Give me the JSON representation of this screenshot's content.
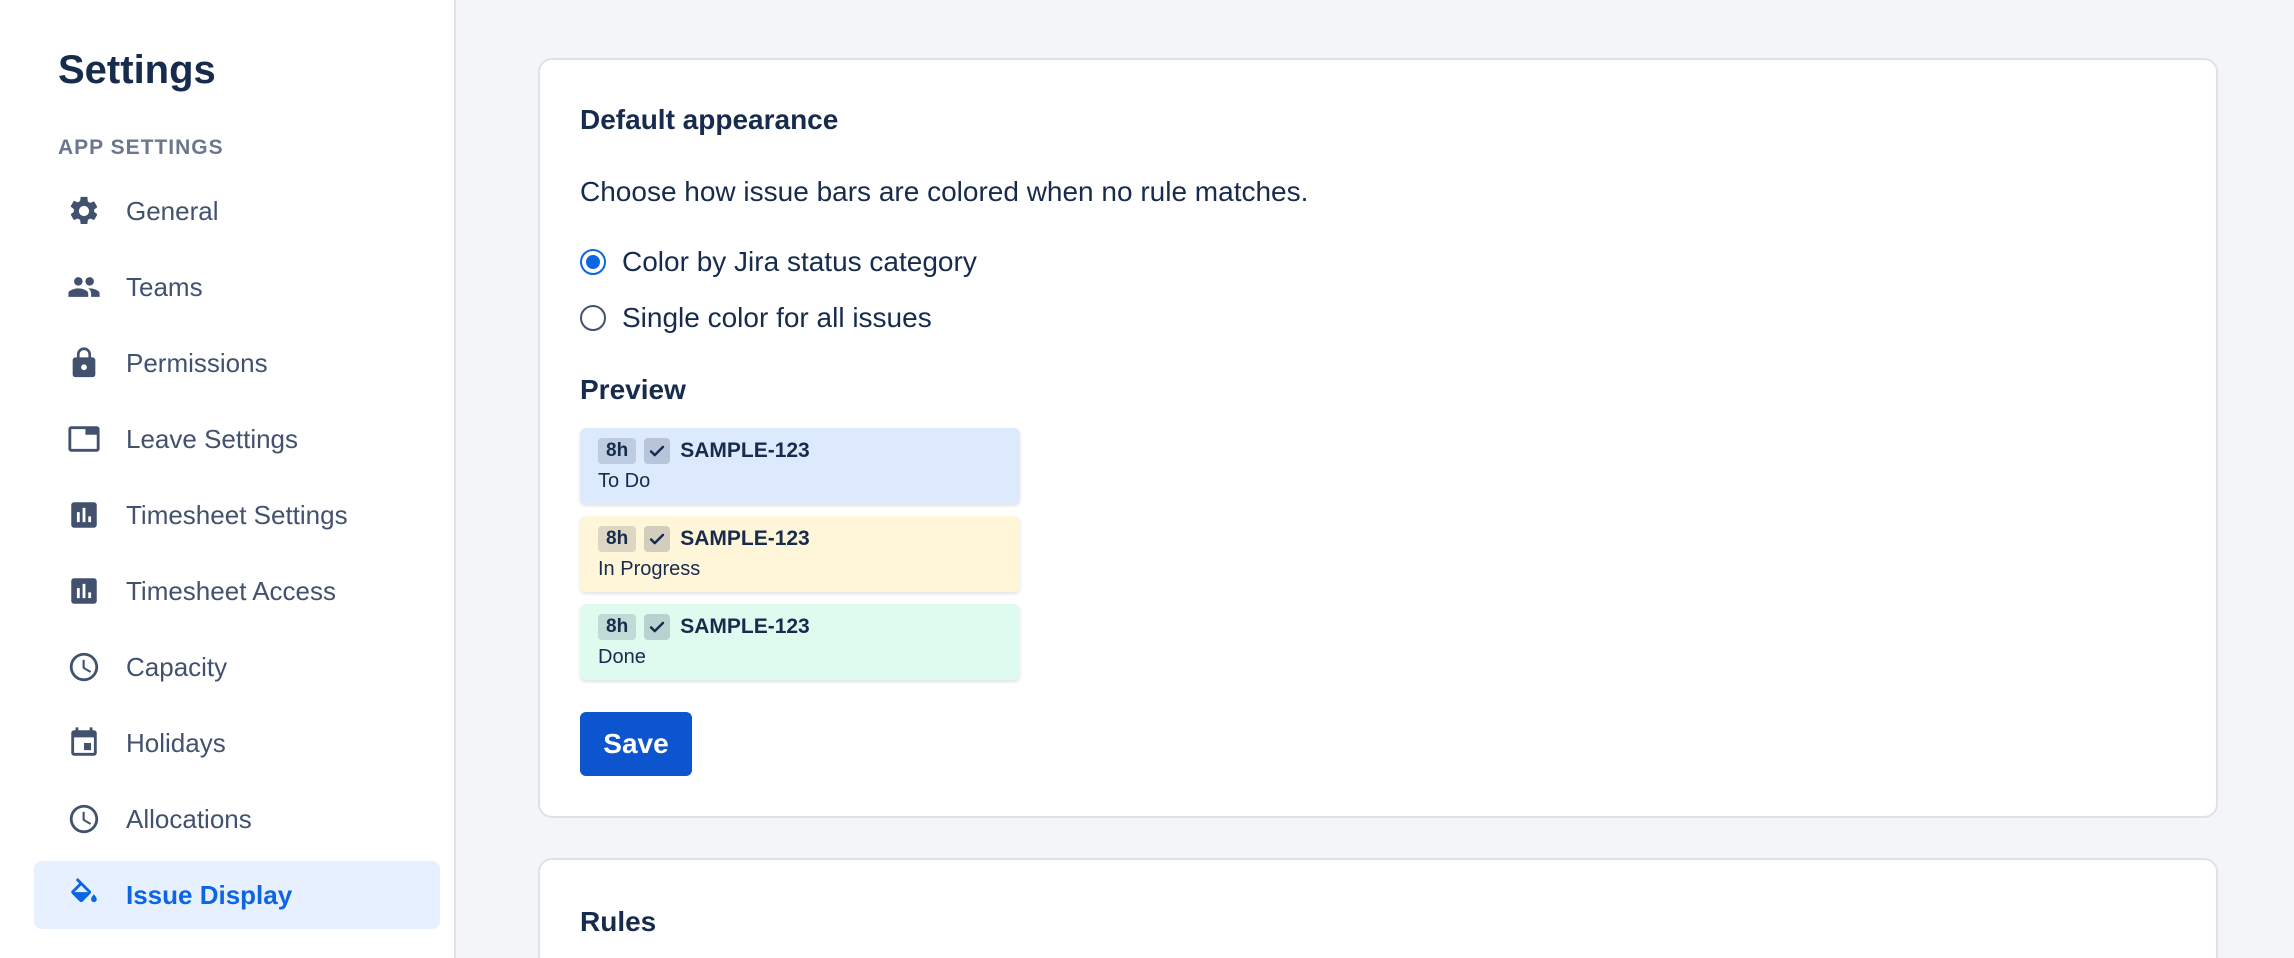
{
  "sidebar": {
    "title": "Settings",
    "section_label": "APP SETTINGS",
    "items": [
      {
        "label": "General",
        "icon": "gear-icon"
      },
      {
        "label": "Teams",
        "icon": "people-icon"
      },
      {
        "label": "Permissions",
        "icon": "lock-icon"
      },
      {
        "label": "Leave Settings",
        "icon": "tab-window-icon"
      },
      {
        "label": "Timesheet Settings",
        "icon": "bar-chart-icon"
      },
      {
        "label": "Timesheet Access",
        "icon": "bar-chart-icon"
      },
      {
        "label": "Capacity",
        "icon": "clock-icon"
      },
      {
        "label": "Holidays",
        "icon": "calendar-icon"
      },
      {
        "label": "Allocations",
        "icon": "clock-icon"
      },
      {
        "label": "Issue Display",
        "icon": "paint-bucket-icon",
        "active": true
      }
    ]
  },
  "default_appearance": {
    "title": "Default appearance",
    "description": "Choose how issue bars are colored when no rule matches.",
    "options": [
      {
        "label": "Color by Jira status category",
        "selected": true
      },
      {
        "label": "Single color for all issues",
        "selected": false
      }
    ],
    "preview_title": "Preview",
    "preview_bars": [
      {
        "hours": "8h",
        "key": "SAMPLE-123",
        "status": "To Do",
        "color": "#dde9fc"
      },
      {
        "hours": "8h",
        "key": "SAMPLE-123",
        "status": "In Progress",
        "color": "#fff5d9"
      },
      {
        "hours": "8h",
        "key": "SAMPLE-123",
        "status": "Done",
        "color": "#dffaee"
      }
    ],
    "save_label": "Save"
  },
  "rules": {
    "title": "Rules"
  },
  "colors": {
    "accent": "#0c66e4",
    "active_bg": "#e6f0ff",
    "save_button": "#0c55cf"
  }
}
